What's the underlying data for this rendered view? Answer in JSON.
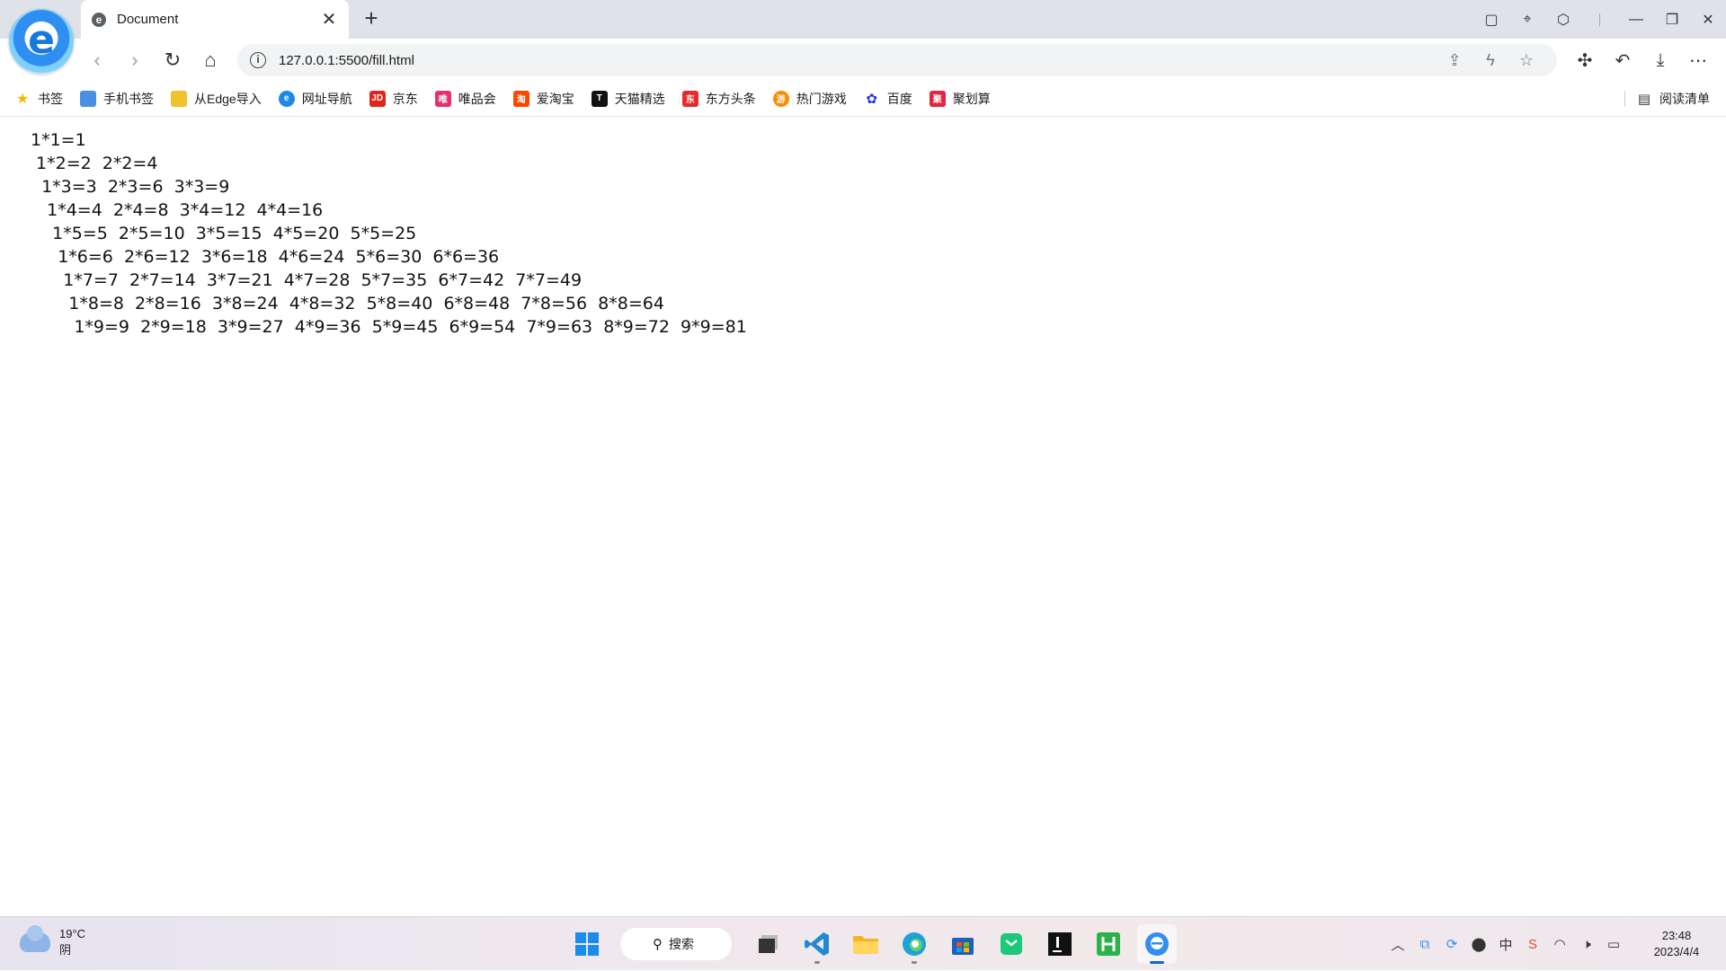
{
  "tab": {
    "title": "Document",
    "close": "✕",
    "new_tab": "+"
  },
  "address": {
    "url": "127.0.0.1:5500/fill.html"
  },
  "bookmarks": [
    {
      "label": "书签",
      "color": "#f5b800",
      "glyph": "★"
    },
    {
      "label": "手机书签",
      "color": "#4a90e2",
      "glyph": "▯"
    },
    {
      "label": "从Edge导入",
      "color": "#f2c12e",
      "glyph": "▬"
    },
    {
      "label": "网址导航",
      "color": "#1e88e5",
      "glyph": "e"
    },
    {
      "label": "京东",
      "color": "#e1251b",
      "glyph": "JD"
    },
    {
      "label": "唯品会",
      "color": "#e6306f",
      "glyph": "唯"
    },
    {
      "label": "爱淘宝",
      "color": "#ff4400",
      "glyph": "淘"
    },
    {
      "label": "天猫精选",
      "color": "#e00000",
      "glyph": "T"
    },
    {
      "label": "东方头条",
      "color": "#e62b2b",
      "glyph": "东"
    },
    {
      "label": "热门游戏",
      "color": "#ff8a00",
      "glyph": "游"
    },
    {
      "label": "百度",
      "color": "#2932e1",
      "glyph": "✿"
    },
    {
      "label": "聚划算",
      "color": "#e5243f",
      "glyph": "聚"
    }
  ],
  "reading_list": "阅读清单",
  "table": [
    "1*1=1",
    " 1*2=2  2*2=4",
    "  1*3=3  2*3=6  3*3=9",
    "   1*4=4  2*4=8  3*4=12  4*4=16",
    "    1*5=5  2*5=10  3*5=15  4*5=20  5*5=25",
    "     1*6=6  2*6=12  3*6=18  4*6=24  5*6=30  6*6=36",
    "      1*7=7  2*7=14  3*7=21  4*7=28  5*7=35  6*7=42  7*7=49",
    "       1*8=8  2*8=16  3*8=24  4*8=32  5*8=40  6*8=48  7*8=56  8*8=64",
    "        1*9=9  2*9=18  3*9=27  4*9=36  5*9=45  6*9=54  7*9=63  8*9=72  9*9=81"
  ],
  "taskbar": {
    "weather_temp": "19°C",
    "weather_desc": "阴",
    "search_label": "搜索",
    "time": "23:48",
    "date": "2023/4/4"
  }
}
